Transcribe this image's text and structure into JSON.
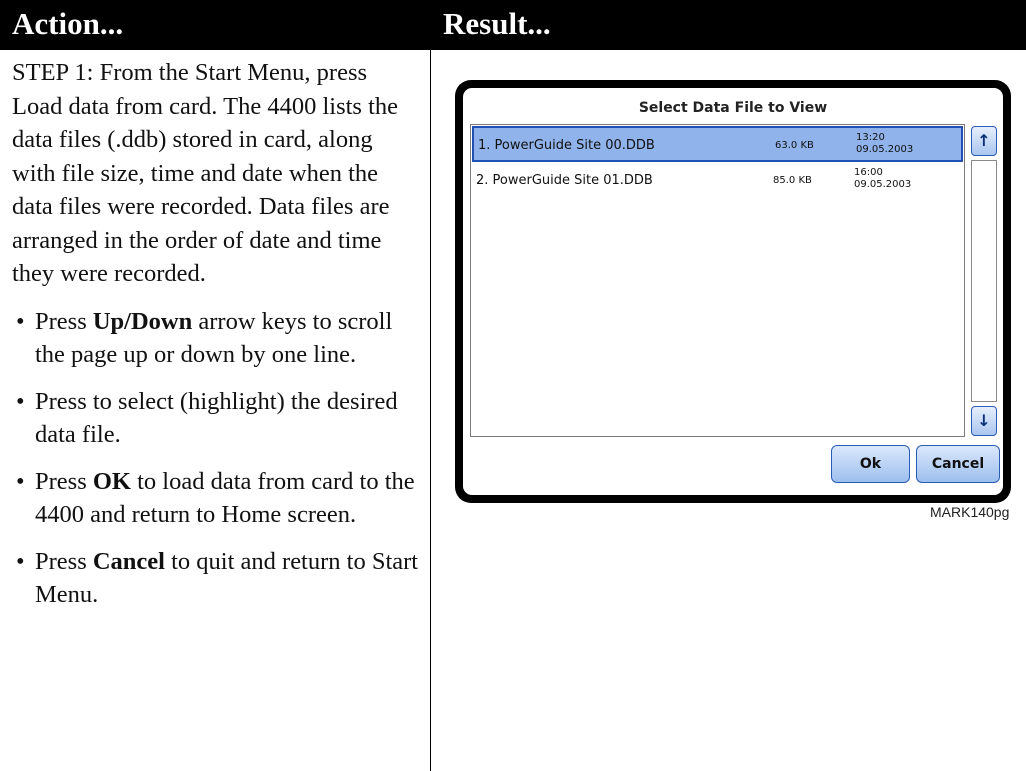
{
  "header": {
    "action_title": "Action...",
    "result_title": "Result..."
  },
  "action": {
    "step": "STEP 1: From the Start Menu, press Load data from card. The 4400 lists the data files (.ddb) stored in card, along with file size, time and date when the data files were recorded. Data files are arranged in the order of date and time they were recorded.",
    "bullet_symbol": "•",
    "bullets": [
      {
        "pre": "Press ",
        "bold": "Up/Down",
        "post": " arrow keys to scroll the page up or down by one line."
      },
      {
        "pre": "Press to select (highlight) the desired data file.",
        "bold": "",
        "post": ""
      },
      {
        "pre": "Press ",
        "bold": "OK",
        "post": " to load data from card to the 4400 and return to Home screen."
      },
      {
        "pre": "Press ",
        "bold": "Cancel",
        "post": " to quit and return to Start Menu."
      }
    ]
  },
  "dialog": {
    "title": "Select Data File to View",
    "files": [
      {
        "name": "1. PowerGuide Site  00.DDB",
        "size": "63.0 KB",
        "time": "13:20",
        "date": "09.05.2003",
        "selected": true
      },
      {
        "name": "2. PowerGuide Site  01.DDB",
        "size": "85.0 KB",
        "time": "16:00",
        "date": "09.05.2003",
        "selected": false
      }
    ],
    "scroll_up": "↑",
    "scroll_down": "↓",
    "ok_label": "Ok",
    "cancel_label": "Cancel"
  },
  "figure_id": "MARK140pg",
  "colors": {
    "selected_row": "#8fb3ea",
    "selected_border": "#1f4fb0",
    "button_border": "#2b5cb8"
  }
}
